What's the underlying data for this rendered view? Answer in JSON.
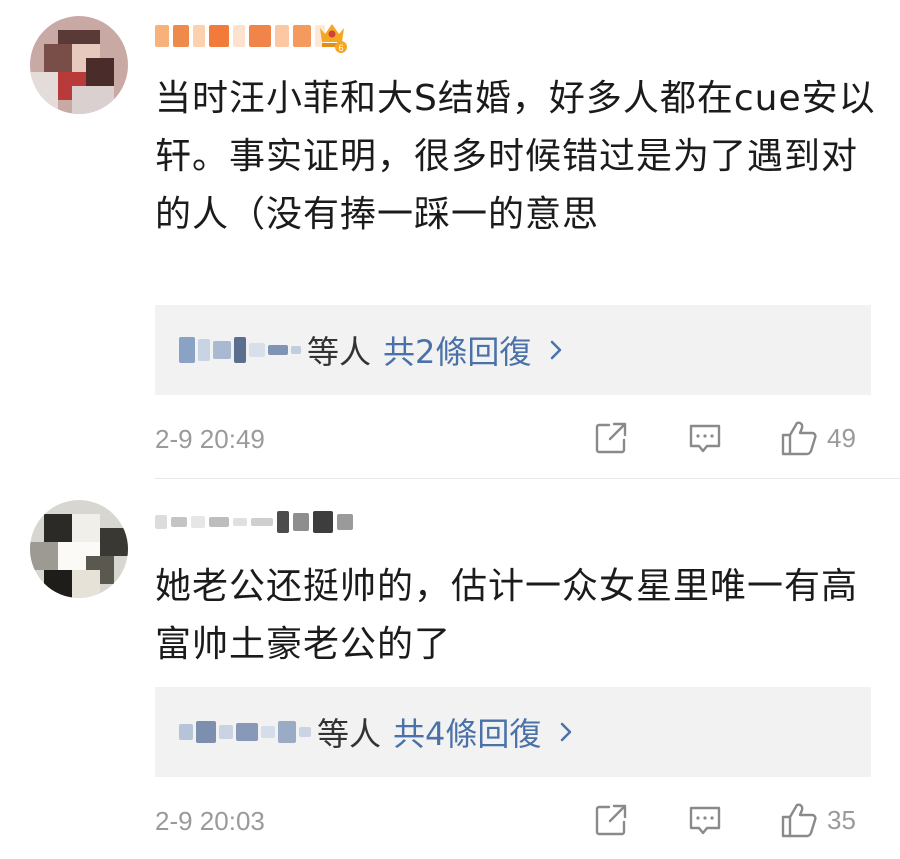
{
  "comments": [
    {
      "text": "当时汪小菲和大S结婚，好多人都在cue安以轩。事实证明，很多时候错过是为了遇到对的人（没有捧一踩一的意思",
      "replies": {
        "suffix": "等人",
        "count_label": "共2條回復"
      },
      "timestamp": "2-9 20:49",
      "likes": "49",
      "vip_badge": true
    },
    {
      "text": "她老公还挺帅的，估计一众女星里唯一有高富帅土豪老公的了",
      "replies": {
        "suffix": "等人",
        "count_label": "共4條回復"
      },
      "timestamp": "2-9 20:03",
      "likes": "35",
      "vip_badge": false
    }
  ],
  "icons": {
    "share": "share-icon",
    "comment": "comment-icon",
    "like": "thumbs-up-icon",
    "chevron": "chevron-right-icon",
    "vip": "vip-crown-badge-icon"
  },
  "colors": {
    "reply_link": "#4a72a9",
    "meta_text": "#9a9a9a",
    "reply_bg": "#f2f2f2",
    "vip_gold": "#f5a623"
  }
}
